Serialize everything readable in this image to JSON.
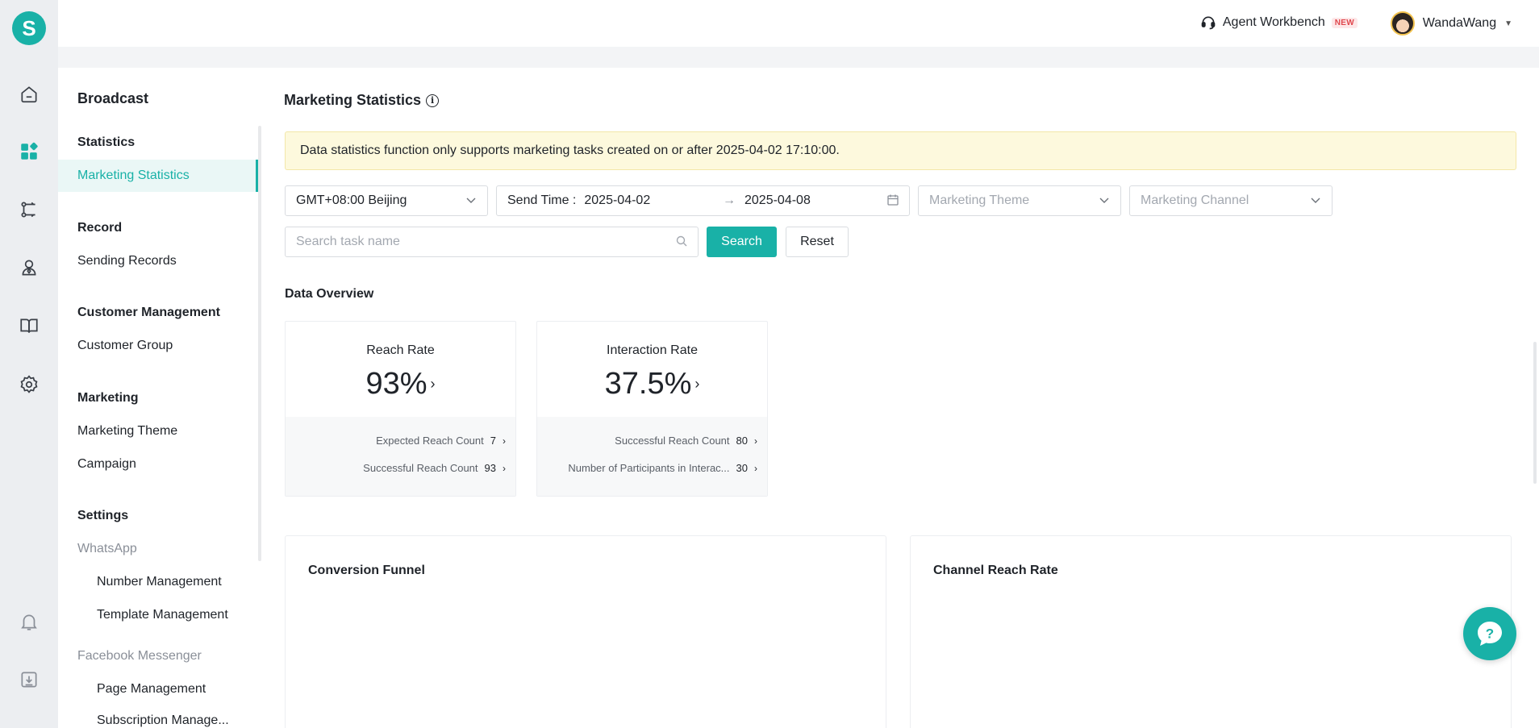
{
  "app": {
    "logo_letter": "S",
    "accent": "#19b1a7"
  },
  "rail": {
    "items": [
      "home-icon",
      "apps-icon",
      "flow-icon",
      "contacts-icon",
      "book-icon",
      "settings-icon",
      "bell-icon",
      "download-icon"
    ]
  },
  "header": {
    "agent_workbench": "Agent Workbench",
    "new_badge": "NEW",
    "username": "WandaWang"
  },
  "sidebar": {
    "title": "Broadcast",
    "groups": {
      "statistics": "Statistics",
      "record": "Record",
      "customer_management": "Customer Management",
      "marketing": "Marketing",
      "settings": "Settings"
    },
    "items": {
      "marketing_statistics": "Marketing Statistics",
      "sending_records": "Sending Records",
      "customer_group": "Customer Group",
      "marketing_theme": "Marketing Theme",
      "campaign": "Campaign",
      "whatsapp": "WhatsApp",
      "number_management": "Number Management",
      "template_management": "Template Management",
      "facebook_messenger": "Facebook Messenger",
      "page_management": "Page Management",
      "subscription_management": "Subscription Manage..."
    }
  },
  "main": {
    "title": "Marketing Statistics",
    "notice": "Data statistics function only supports marketing tasks created on or after 2025-04-02 17:10:00.",
    "filters": {
      "timezone": "GMT+08:00 Beijing",
      "send_time_label": "Send Time :",
      "date_start": "2025-04-02",
      "date_end": "2025-04-08",
      "theme_placeholder": "Marketing Theme",
      "channel_placeholder": "Marketing Channel",
      "search_placeholder": "Search task name",
      "search_button": "Search",
      "reset_button": "Reset"
    },
    "overview_title": "Data Overview",
    "cards": [
      {
        "label": "Reach Rate",
        "value": "93%",
        "rows": [
          {
            "label": "Expected Reach Count",
            "value": "7"
          },
          {
            "label": "Successful Reach Count",
            "value": "93"
          }
        ]
      },
      {
        "label": "Interaction Rate",
        "value": "37.5%",
        "rows": [
          {
            "label": "Successful Reach Count",
            "value": "80"
          },
          {
            "label": "Number of Participants in Interac...",
            "value": "30"
          }
        ]
      }
    ],
    "panels": {
      "conversion_funnel": "Conversion Funnel",
      "channel_reach_rate": "Channel Reach Rate"
    }
  }
}
